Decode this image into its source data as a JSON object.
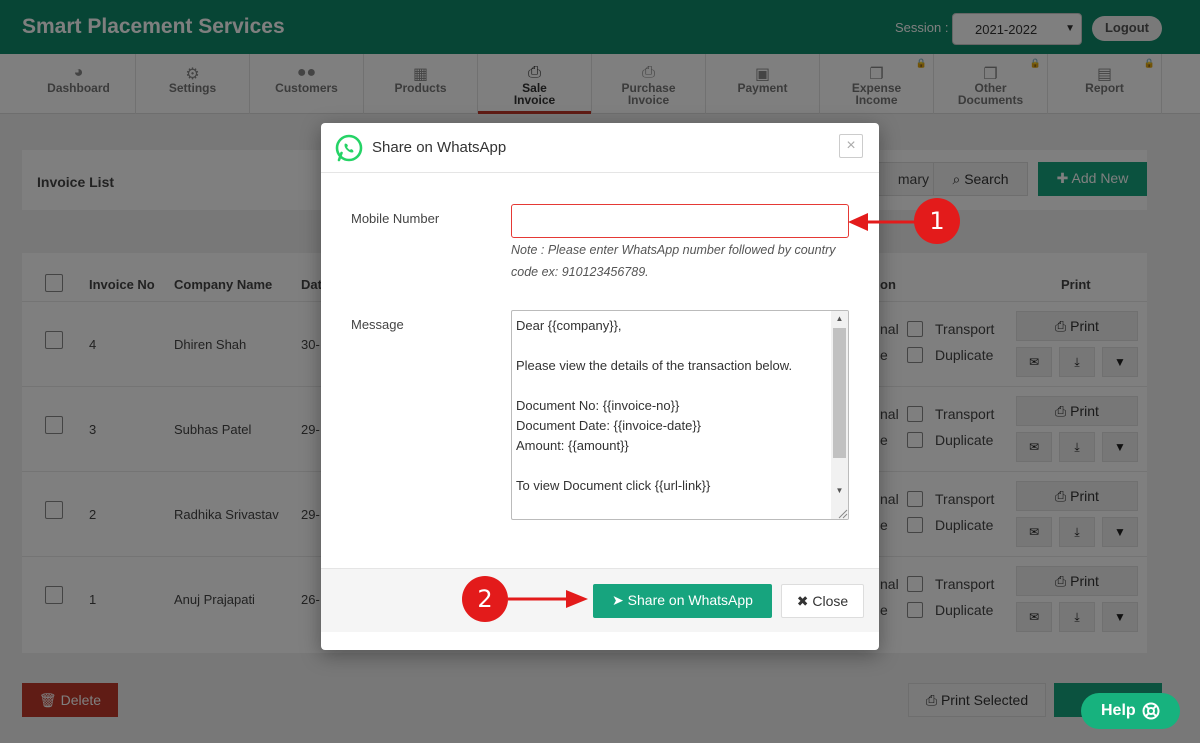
{
  "app": {
    "title": "Smart Placement Services",
    "session_label": "Session :",
    "session_value": "2021-2022",
    "logout_label": "Logout"
  },
  "nav": {
    "items": [
      {
        "label": "Dashboard",
        "icon": "dashboard-icon",
        "locked": false
      },
      {
        "label": "Settings",
        "icon": "gear-icon",
        "locked": false
      },
      {
        "label": "Customers",
        "icon": "users-icon",
        "locked": false
      },
      {
        "label": "Products",
        "icon": "cubes-icon",
        "locked": false
      },
      {
        "label": "Sale Invoice",
        "icon": "printer-icon",
        "locked": false,
        "active": true
      },
      {
        "label": "Purchase Invoice",
        "icon": "printer-icon",
        "locked": false
      },
      {
        "label": "Payment",
        "icon": "money-icon",
        "locked": false
      },
      {
        "label": "Expense Income",
        "icon": "copy-icon",
        "locked": true
      },
      {
        "label": "Other Documents",
        "icon": "copy-icon",
        "locked": true
      },
      {
        "label": "Report",
        "icon": "newspaper-icon",
        "locked": true
      }
    ]
  },
  "list": {
    "title": "Invoice List",
    "summary_fragment": "mary",
    "search_label": "Search",
    "add_new_label": "Add New",
    "columns": {
      "invoice_no": "Invoice No",
      "company": "Company Name",
      "date_fragment": "Dat",
      "option_fragment": "on",
      "print": "Print"
    },
    "rows": [
      {
        "invoice_no": "4",
        "company": "Dhiren Shah",
        "date_fragment": "30-"
      },
      {
        "invoice_no": "3",
        "company": "Subhas Patel",
        "date_fragment": "29-"
      },
      {
        "invoice_no": "2",
        "company": "Radhika Srivastav",
        "date_fragment": "29-"
      },
      {
        "invoice_no": "1",
        "company": "Anuj Prajapati",
        "date_fragment": "26-"
      }
    ],
    "option_frag_1": "nal",
    "option_frag_2": "e",
    "transport_label": "Transport",
    "duplicate_label": "Duplicate",
    "print_label": "Print",
    "delete_label": "Delete",
    "print_selected_label": "Print Selected"
  },
  "modal": {
    "title": "Share on WhatsApp",
    "close_x": "×",
    "mobile_label": "Mobile Number",
    "mobile_value": "",
    "note": "Note : Please enter WhatsApp number followed by country code ex: 910123456789.",
    "message_label": "Message",
    "message_value": "Dear {{company}},\n\nPlease view the details of the transaction below.\n\nDocument No: {{invoice-no}}\nDocument Date: {{invoice-date}}\nAmount: {{amount}}\n\nTo view Document click {{url-link}}",
    "share_label": "Share on WhatsApp",
    "close_label": "Close"
  },
  "annotations": {
    "step1": "1",
    "step2": "2",
    "color": "#e31b1b"
  },
  "help": {
    "label": "Help"
  },
  "colors": {
    "brand": "#0f8a6a",
    "accent_green": "#17a47e",
    "danger": "#c0392b",
    "annotation_red": "#e31b1b"
  }
}
